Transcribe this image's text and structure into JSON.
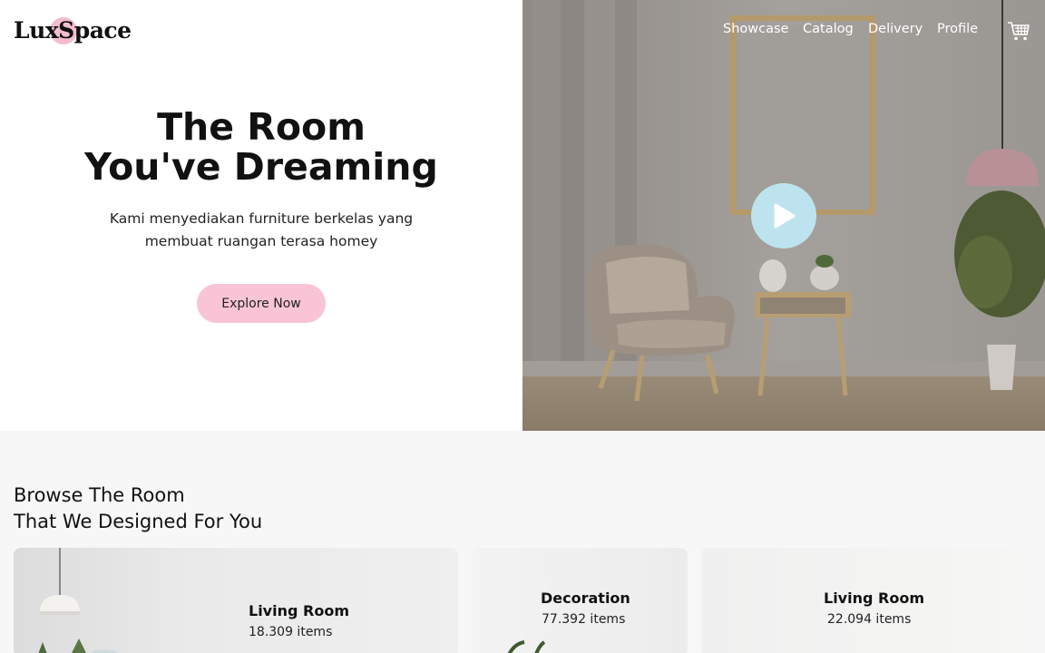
{
  "brand": {
    "name": "LuxSpace",
    "accent": "#f9c4d6"
  },
  "nav": {
    "items": [
      "Showcase",
      "Catalog",
      "Delivery",
      "Profile"
    ],
    "cart_icon": "cart-icon"
  },
  "hero": {
    "title_line1": "The Room",
    "title_line2": "You've Dreaming",
    "subtitle_line1": "Kami menyediakan furniture berkelas yang",
    "subtitle_line2": "membuat ruangan terasa homey",
    "cta": "Explore Now",
    "play_icon": "play-icon"
  },
  "browse": {
    "title_line1": "Browse The Room",
    "title_line2": "That We Designed For You",
    "cards": [
      {
        "title": "Living Room",
        "count": "18.309 items"
      },
      {
        "title": "Decoration",
        "count": "77.392 items"
      },
      {
        "title": "Living Room",
        "count": "22.094 items"
      }
    ]
  }
}
